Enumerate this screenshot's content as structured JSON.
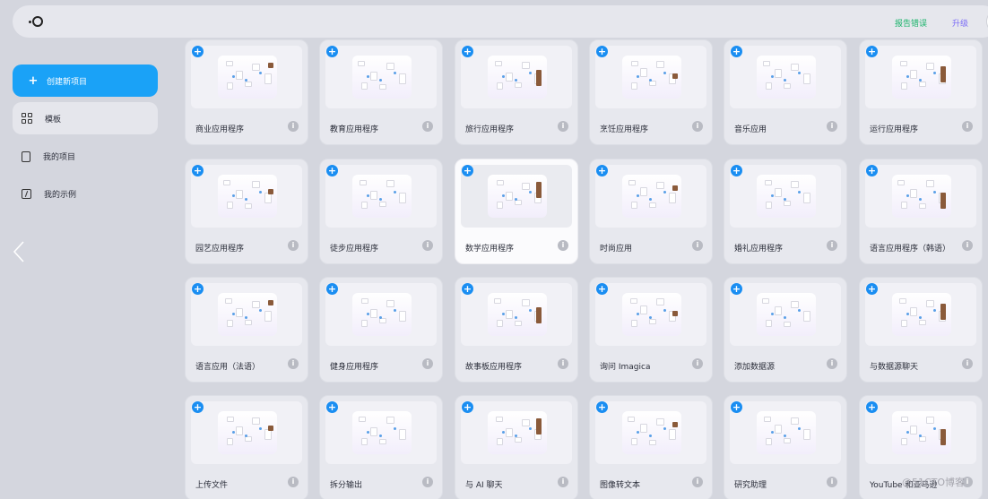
{
  "topbar": {
    "feedback_label": "报告错误",
    "upgrade_label": "升级"
  },
  "sidebar": {
    "create_label": "创建新项目",
    "items": [
      {
        "label": "模板"
      },
      {
        "label": "我的项目"
      },
      {
        "label": "我的示例"
      }
    ]
  },
  "cards": [
    {
      "title": "商业应用程序"
    },
    {
      "title": "教育应用程序"
    },
    {
      "title": "旅行应用程序"
    },
    {
      "title": "烹饪应用程序"
    },
    {
      "title": "音乐应用"
    },
    {
      "title": "运行应用程序"
    },
    {
      "title": "园艺应用程序"
    },
    {
      "title": "徒步应用程序"
    },
    {
      "title": "数学应用程序"
    },
    {
      "title": "时尚应用"
    },
    {
      "title": "婚礼应用程序"
    },
    {
      "title": "语言应用程序（韩语）"
    },
    {
      "title": "语言应用（法语）"
    },
    {
      "title": "健身应用程序"
    },
    {
      "title": "故事板应用程序"
    },
    {
      "title": "询问 Imagica"
    },
    {
      "title": "添加数据源"
    },
    {
      "title": "与数据源聊天"
    },
    {
      "title": "上传文件"
    },
    {
      "title": "拆分输出"
    },
    {
      "title": "与 AI 聊天"
    },
    {
      "title": "图像转文本"
    },
    {
      "title": "研究助理"
    },
    {
      "title": "YouTube 和亚马逊"
    }
  ],
  "watermark": "@51CTO博客",
  "colors": {
    "accent": "#1aa2f7",
    "feedback": "#19b36a",
    "upgrade": "#7b6cf6",
    "badge": "#1a8ef2"
  }
}
